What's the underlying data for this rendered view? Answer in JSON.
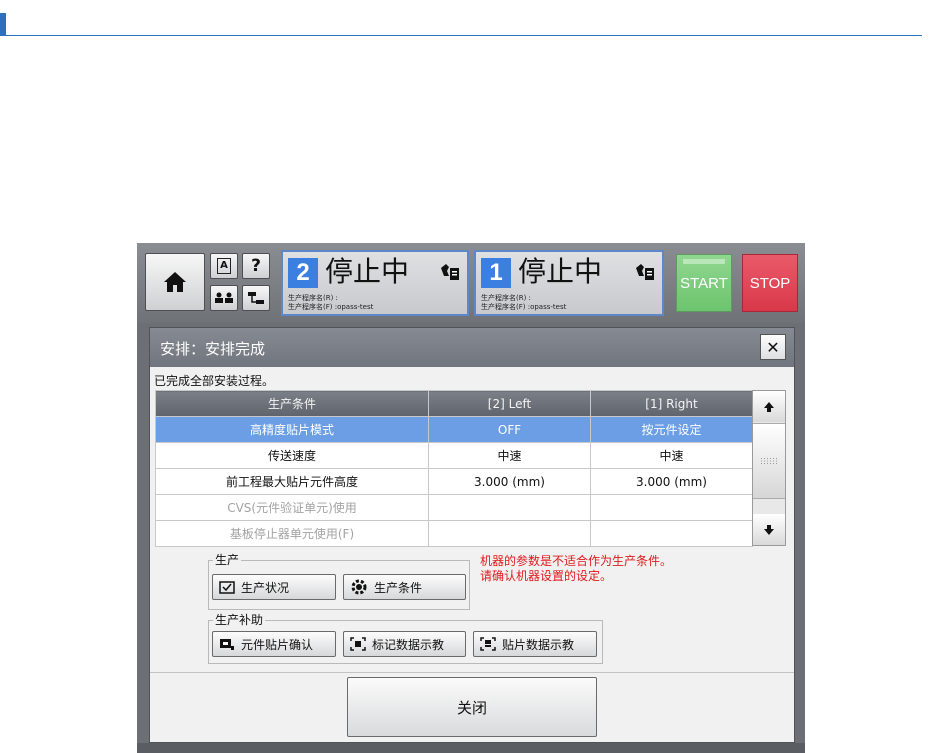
{
  "screen": {
    "lanes": [
      {
        "number": "2",
        "state": "停止中",
        "program_r": "生产程序名(R) :",
        "program_f": "生产程序名(F) :opass-test"
      },
      {
        "number": "1",
        "state": "停止中",
        "program_r": "生产程序名(R) :",
        "program_f": "生产程序名(F) :opass-test"
      }
    ],
    "start_label": "START",
    "stop_label": "STOP",
    "help_label": "?",
    "font_btn_label": "A"
  },
  "dialog": {
    "title": "安排：安排完成",
    "close_glyph": "✕",
    "message": "已完成全部安装过程。",
    "table": {
      "headers": [
        "生产条件",
        "[2] Left",
        "[1] Right"
      ],
      "rows": [
        [
          "高精度贴片模式",
          "OFF",
          "按元件设定"
        ],
        [
          "传送速度",
          "中速",
          "中速"
        ],
        [
          "前工程最大贴片元件高度",
          "3.000 (mm)",
          "3.000 (mm)"
        ],
        [
          "CVS(元件验证单元)使用",
          "",
          ""
        ],
        [
          "基板停止器单元使用(F)",
          "",
          ""
        ]
      ]
    },
    "production_group": {
      "label": "生产",
      "status_button": "生产状况",
      "conditions_button": "生产条件"
    },
    "warning_lines": [
      "机器的参数是不适合作为生产条件。",
      "请确认机器设置的设定。"
    ],
    "assist_group": {
      "label": "生产补助",
      "component_button": "元件贴片确认",
      "mark_button": "标记数据示教",
      "placement_button": "贴片数据示教"
    },
    "close_button": "关闭"
  },
  "colors": {
    "accent_blue": "#2f6fbf",
    "selected_row": "#6b9ee4",
    "start_green": "#6dc46e",
    "stop_red": "#d93849",
    "warning_red": "#e01a1a"
  },
  "icons": [
    "home-icon",
    "font-icon",
    "help-icon",
    "operators-icon",
    "network-icon",
    "hand-card-icon",
    "arrow-up-icon",
    "arrow-down-icon",
    "grip-icon",
    "status-check-icon",
    "gear-condition-icon",
    "component-check-icon",
    "mark-teach-icon",
    "placement-teach-icon"
  ]
}
